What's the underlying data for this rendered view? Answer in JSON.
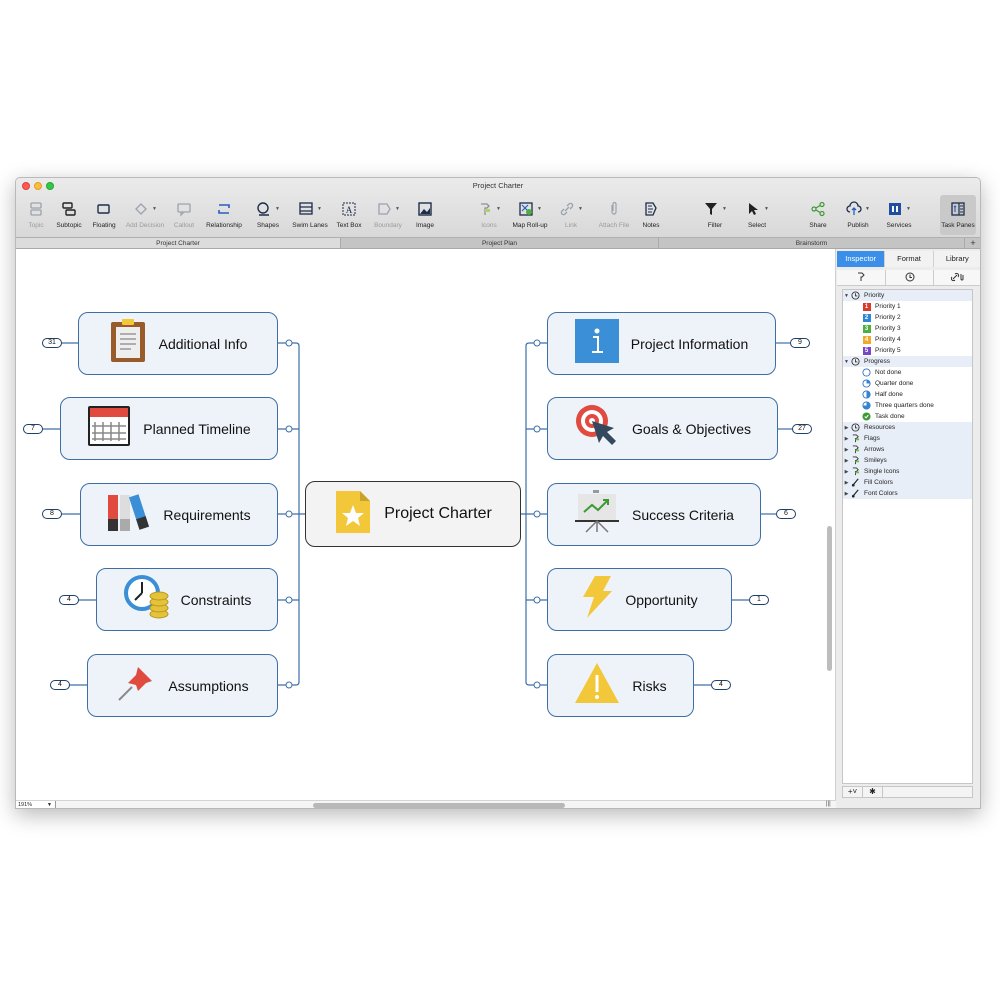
{
  "window": {
    "title": "Project Charter"
  },
  "toolbar": {
    "items": [
      {
        "label": "Topic",
        "icon": "topic-icon",
        "enabled": false
      },
      {
        "label": "Subtopic",
        "icon": "subtopic-icon",
        "enabled": true
      },
      {
        "label": "Floating",
        "icon": "floating-topic-icon",
        "enabled": true
      },
      {
        "label": "Add Decision",
        "icon": "decision-icon",
        "enabled": false
      },
      {
        "label": "Callout",
        "icon": "callout-icon",
        "enabled": false
      },
      {
        "label": "Relationship",
        "icon": "relationship-icon",
        "enabled": true
      },
      {
        "label": "Shapes",
        "icon": "shapes-icon",
        "enabled": true
      },
      {
        "label": "Swim Lanes",
        "icon": "swim-lanes-icon",
        "enabled": true
      },
      {
        "label": "Text Box",
        "icon": "text-box-icon",
        "enabled": true
      },
      {
        "label": "Boundary",
        "icon": "boundary-icon",
        "enabled": false
      },
      {
        "label": "Image",
        "icon": "image-icon",
        "enabled": true
      },
      {
        "label": "Icons",
        "icon": "icons-icon",
        "enabled": false
      },
      {
        "label": "Map Roll-up",
        "icon": "map-rollup-icon",
        "enabled": true
      },
      {
        "label": "Link",
        "icon": "link-icon",
        "enabled": false
      },
      {
        "label": "Attach File",
        "icon": "paperclip-icon",
        "enabled": false
      },
      {
        "label": "Notes",
        "icon": "notes-icon",
        "enabled": true
      },
      {
        "label": "Filter",
        "icon": "filter-icon",
        "enabled": true
      },
      {
        "label": "Select",
        "icon": "cursor-icon",
        "enabled": true
      },
      {
        "label": "Share",
        "icon": "share-icon",
        "enabled": true
      },
      {
        "label": "Publish",
        "icon": "cloud-upload-icon",
        "enabled": true
      },
      {
        "label": "Services",
        "icon": "services-icon",
        "enabled": true
      },
      {
        "label": "Task Panes",
        "icon": "task-panes-icon",
        "enabled": true
      }
    ]
  },
  "doc_tabs": [
    {
      "label": "Project Charter",
      "active": true
    },
    {
      "label": "Project Plan",
      "active": false
    },
    {
      "label": "Brainstorm",
      "active": false
    }
  ],
  "doc_tabs_add": "+",
  "map": {
    "central": {
      "label": "Project Charter",
      "icon": "star-document-icon"
    },
    "left": [
      {
        "label": "Additional Info",
        "icon": "clipboard-icon",
        "count": "31"
      },
      {
        "label": "Planned Timeline",
        "icon": "calendar-icon",
        "count": "7"
      },
      {
        "label": "Requirements",
        "icon": "binders-icon",
        "count": "8"
      },
      {
        "label": "Constraints",
        "icon": "clock-coins-icon",
        "count": "4"
      },
      {
        "label": "Assumptions",
        "icon": "pushpin-icon",
        "count": "4"
      }
    ],
    "right": [
      {
        "label": "Project Information",
        "icon": "info-icon",
        "count": "9"
      },
      {
        "label": "Goals & Objectives",
        "icon": "target-icon",
        "count": "27"
      },
      {
        "label": "Success Criteria",
        "icon": "presentation-chart-icon",
        "count": "6"
      },
      {
        "label": "Opportunity",
        "icon": "lightning-icon",
        "count": "1"
      },
      {
        "label": "Risks",
        "icon": "warning-icon",
        "count": "4"
      }
    ]
  },
  "status": {
    "zoom": "191%"
  },
  "pane": {
    "tabs": [
      {
        "label": "Inspector",
        "active": true
      },
      {
        "label": "Format",
        "active": false
      },
      {
        "label": "Library",
        "active": false
      }
    ],
    "subtabs": [
      "icons-tab-icon",
      "task-info-icon",
      "links-tab-icon"
    ],
    "groups": [
      {
        "label": "Priority",
        "expanded": true,
        "items": [
          {
            "label": "Priority 1",
            "badge": "1",
            "color": "#d93a2b"
          },
          {
            "label": "Priority 2",
            "badge": "2",
            "color": "#2f86d6"
          },
          {
            "label": "Priority 3",
            "badge": "3",
            "color": "#4caf3f"
          },
          {
            "label": "Priority 4",
            "badge": "4",
            "color": "#f0a92b"
          },
          {
            "label": "Priority 5",
            "badge": "5",
            "color": "#7a45c9"
          }
        ]
      },
      {
        "label": "Progress",
        "expanded": true,
        "items": [
          {
            "label": "Not done",
            "progress": 0
          },
          {
            "label": "Quarter done",
            "progress": 25
          },
          {
            "label": "Half done",
            "progress": 50
          },
          {
            "label": "Three quarters done",
            "progress": 75
          },
          {
            "label": "Task done",
            "progress": 100
          }
        ]
      },
      {
        "label": "Resources",
        "expanded": false
      },
      {
        "label": "Flags",
        "expanded": false
      },
      {
        "label": "Arrows",
        "expanded": false
      },
      {
        "label": "Smileys",
        "expanded": false
      },
      {
        "label": "Single Icons",
        "expanded": false
      },
      {
        "label": "Fill Colors",
        "expanded": false
      },
      {
        "label": "Font Colors",
        "expanded": false
      }
    ],
    "footer": {
      "add_label": "+˅",
      "settings_icon": "gear-icon"
    }
  },
  "colors": {
    "accent": "#3b8fe8",
    "connector": "#3d6fa6",
    "topic_fill": "#eef3f9"
  }
}
